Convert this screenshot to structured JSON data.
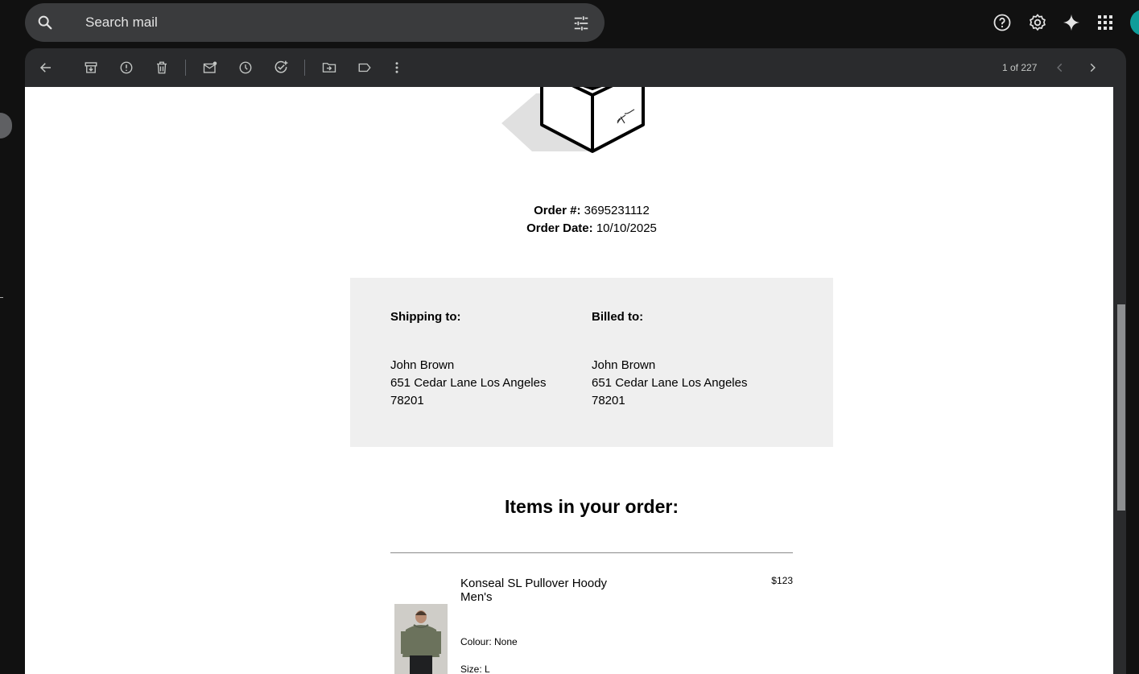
{
  "search": {
    "placeholder": "Search mail"
  },
  "topbar": {
    "icons": [
      "help-icon",
      "settings-icon",
      "gemini-sparkle-icon",
      "apps-grid-icon",
      "account-avatar"
    ]
  },
  "toolbar": {
    "icons": [
      "back-arrow-icon",
      "archive-icon",
      "report-spam-icon",
      "delete-icon",
      "mark-unread-icon",
      "snooze-icon",
      "add-to-tasks-icon",
      "move-to-icon",
      "label-icon",
      "more-vert-icon"
    ],
    "pager_text": "1 of 227"
  },
  "order": {
    "number_label": "Order #:",
    "number_value": "3695231112",
    "date_label": "Order Date:",
    "date_value": "10/10/2025"
  },
  "shipping": {
    "heading": "Shipping to:",
    "name": "John Brown",
    "street": "651 Cedar Lane Los Angeles",
    "zip": "78201"
  },
  "billing": {
    "heading": "Billed to:",
    "name": "John Brown",
    "street": "651 Cedar Lane Los Angeles",
    "zip": "78201"
  },
  "items": {
    "title": "Items in your order:",
    "list": [
      {
        "name_line1": "Konseal SL Pullover Hoody",
        "name_line2": "Men's",
        "price": "$123",
        "colour": "Colour: None",
        "size": "Size: L"
      }
    ]
  },
  "colors": {
    "background": "#111111",
    "panel": "#2a2b2d",
    "search_bg": "#3a3b3d",
    "address_box": "#efefef",
    "avatar": "#0f9d9a"
  }
}
